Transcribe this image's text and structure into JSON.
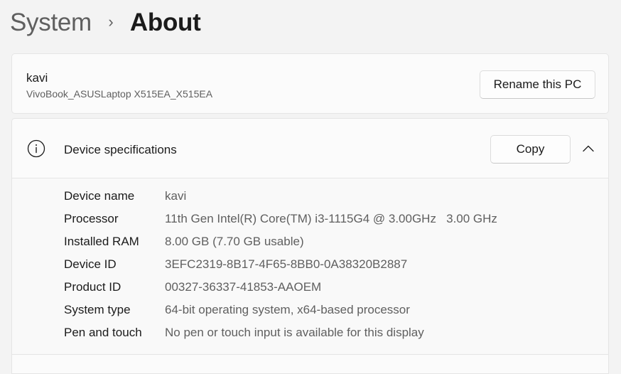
{
  "breadcrumb": {
    "parent": "System",
    "separator": "›",
    "current": "About"
  },
  "pc": {
    "name": "kavi",
    "model": "VivoBook_ASUSLaptop X515EA_X515EA",
    "rename_label": "Rename this PC"
  },
  "device_specs": {
    "icon": "info-icon",
    "title": "Device specifications",
    "copy_label": "Copy",
    "expanded": true,
    "rows": [
      {
        "label": "Device name",
        "value": "kavi"
      },
      {
        "label": "Processor",
        "value": "11th Gen Intel(R) Core(TM) i3-1115G4 @ 3.00GHz   3.00 GHz"
      },
      {
        "label": "Installed RAM",
        "value": "8.00 GB (7.70 GB usable)"
      },
      {
        "label": "Device ID",
        "value": "3EFC2319-8B17-4F65-8BB0-0A38320B2887"
      },
      {
        "label": "Product ID",
        "value": "00327-36337-41853-AAOEM"
      },
      {
        "label": "System type",
        "value": "64-bit operating system, x64-based processor"
      },
      {
        "label": "Pen and touch",
        "value": "No pen or touch input is available for this display"
      }
    ]
  }
}
